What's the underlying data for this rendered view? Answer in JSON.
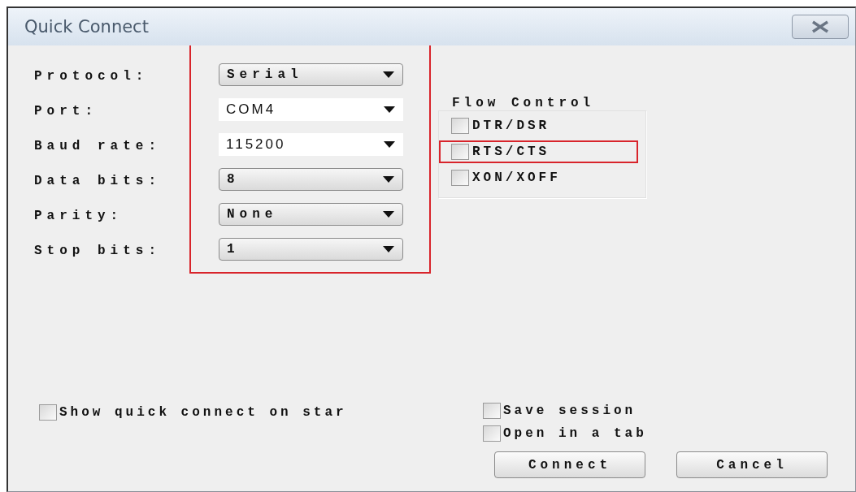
{
  "window": {
    "title": "Quick Connect"
  },
  "settings": {
    "highlighted": true,
    "fields": [
      {
        "label": "Protocol:",
        "value": "Serial",
        "kind": "dropdown"
      },
      {
        "label": "Port:",
        "value": "COM4",
        "kind": "combo"
      },
      {
        "label": "Baud rate:",
        "value": "115200",
        "kind": "combo"
      },
      {
        "label": "Data bits:",
        "value": "8",
        "kind": "dropdown"
      },
      {
        "label": "Parity:",
        "value": "None",
        "kind": "dropdown"
      },
      {
        "label": "Stop bits:",
        "value": "1",
        "kind": "dropdown"
      }
    ]
  },
  "flow_control": {
    "title": "Flow Control",
    "options": [
      {
        "label": "DTR/DSR",
        "checked": false,
        "highlighted": false
      },
      {
        "label": "RTS/CTS",
        "checked": false,
        "highlighted": true
      },
      {
        "label": "XON/XOFF",
        "checked": false,
        "highlighted": false
      }
    ]
  },
  "options": [
    {
      "label": "Show quick connect on star",
      "checked": false
    },
    {
      "label": "Save session",
      "checked": false
    },
    {
      "label": "Open in a tab",
      "checked": false
    }
  ],
  "buttons": [
    "Connect",
    "Cancel"
  ]
}
